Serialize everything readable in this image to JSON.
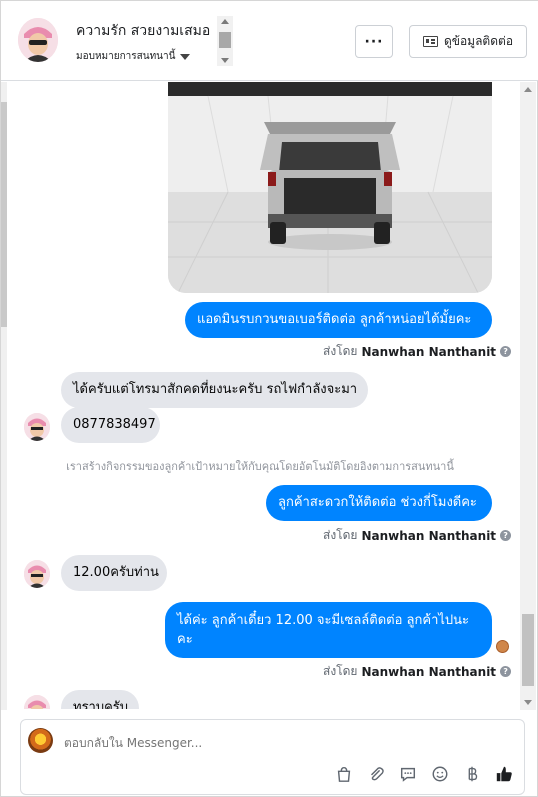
{
  "header": {
    "name": "ความรัก สวยงามเสมอ",
    "assignment": "มอบหมายการสนทนานี้",
    "more_label": "···",
    "contact_label": "ดูข้อมูลติดต่อ"
  },
  "messages": {
    "m1": "แอดมินรบกวนขอเบอร์ติดต่อ ลูกค้าหน่อยได้มั้ยคะ",
    "m2": "ได้ครับแต่โทรมาสักคดที่ยงนะครับ รถไฟกำลังจะมา",
    "m3": "0877838497",
    "m4": "ลูกค้าสะดวกให้ติดต่อ ช่วงกี่โมงดีคะ",
    "m5": "12.00ครับท่าน",
    "m6a": "ได้ค่ะ ลูกค้าเดี๋ยว 12.00 จะมีเซลล์ติดต่อ ลูกค้าไปนะ",
    "m6b": "คะ",
    "m7": "ทราบครับ"
  },
  "sent_by": {
    "prefix": "ส่งโดย",
    "name": "Nanwhan Nanthanit",
    "help": "?"
  },
  "system_notice": "เราสร้างกิจกรรมของลูกค้าเป้าหมายให้กับคุณโดยอัตโนมัติโดยอิงตามการสนทนานี้",
  "composer": {
    "placeholder": "ตอบกลับใน Messenger..."
  },
  "icons": [
    "more-icon",
    "id-card-icon",
    "shopping-bag-icon",
    "paperclip-icon",
    "saved-reply-icon",
    "emoji-icon",
    "baht-icon",
    "thumbs-up-icon"
  ],
  "colors": {
    "outgoing": "#0084ff",
    "incoming": "#e4e6eb",
    "muted": "#606770"
  }
}
